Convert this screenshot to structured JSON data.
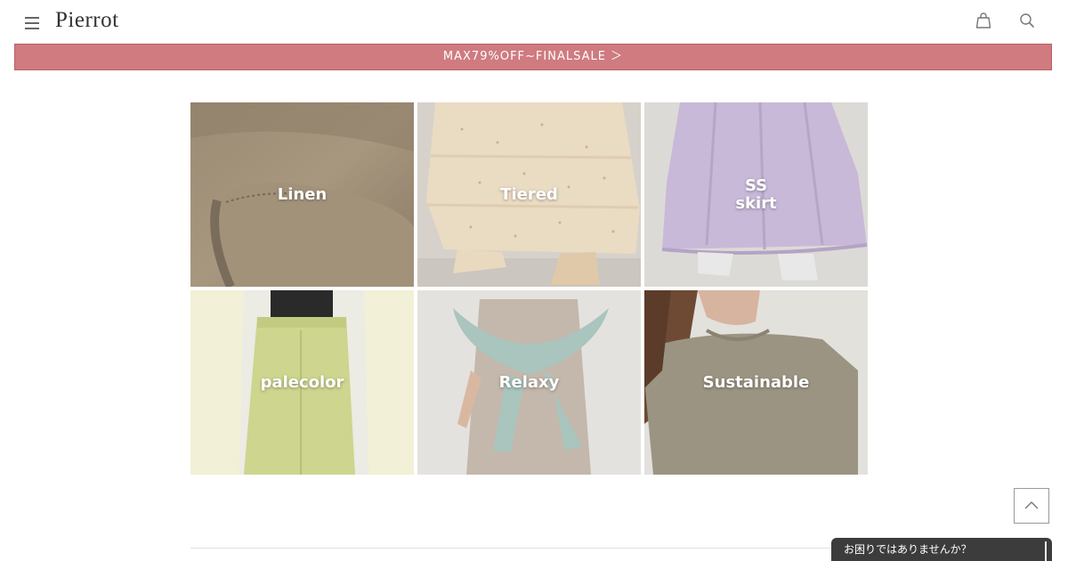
{
  "header": {
    "logo": "Pierrot",
    "menu_icon": "hamburger-menu-icon",
    "cart_icon": "shopping-bag-icon",
    "search_icon": "search-icon"
  },
  "banner": {
    "text": "MAX79%OFF~FINALSALE ＞",
    "background": "#cf7b80"
  },
  "categories": [
    {
      "label_lines": [
        "Linen"
      ]
    },
    {
      "label_lines": [
        "Tiered"
      ]
    },
    {
      "label_lines": [
        "SS",
        "skirt"
      ]
    },
    {
      "label_lines": [
        "palecolor"
      ]
    },
    {
      "label_lines": [
        "Relaxy"
      ]
    },
    {
      "label_lines": [
        "Sustainable"
      ]
    }
  ],
  "back_to_top": {
    "icon": "chevron-up-icon"
  },
  "help_chat": {
    "label": "お困りではありませんか？"
  }
}
